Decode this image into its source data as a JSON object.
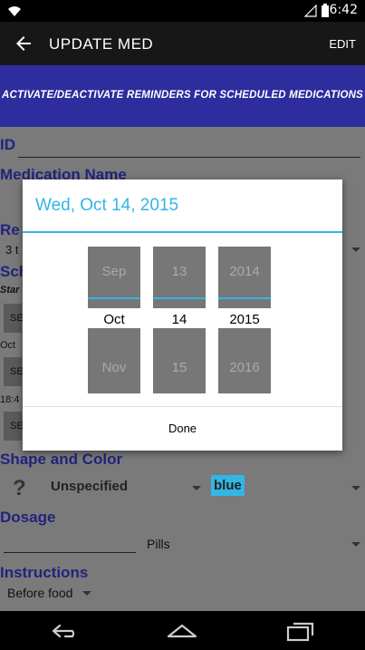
{
  "status_bar": {
    "time": "6:42"
  },
  "action_bar": {
    "title": "UPDATE MED",
    "edit_label": "EDIT"
  },
  "banner": {
    "text": "ACTIVATE/DEACTIVATE REMINDERS FOR SCHEDULED MEDICATIONS"
  },
  "form": {
    "id_label": "ID",
    "medication_name_label": "Medication Name",
    "reminder_label_partial": "Re",
    "reminder_value_partial": "3 t",
    "schedule_label_partial": "Sch",
    "start_partial": "Star",
    "set_button_partial": "SE",
    "date_partial": "Oct",
    "time_partial": "18:4",
    "shape_color_label": "Shape and Color",
    "shape_value": "Unspecified",
    "color_value": "blue",
    "dosage_label": "Dosage",
    "dosage_unit": "Pills",
    "instructions_label": "Instructions",
    "instructions_value": "Before food",
    "shape_icon_glyph": "?"
  },
  "date_dialog": {
    "title": "Wed, Oct 14, 2015",
    "month": {
      "prev": "Sep",
      "selected": "Oct",
      "next": "Nov"
    },
    "day": {
      "prev": "13",
      "selected": "14",
      "next": "15"
    },
    "year": {
      "prev": "2014",
      "selected": "2015",
      "next": "2016"
    },
    "done_label": "Done"
  },
  "colors": {
    "accent": "#33b5e5",
    "banner": "#2d2d9e",
    "label": "#23237e",
    "color_chip": "#33b5e5"
  }
}
